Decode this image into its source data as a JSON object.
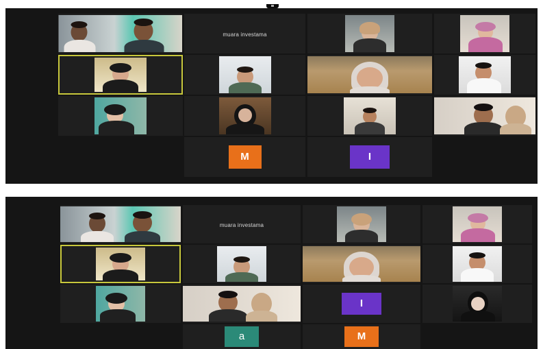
{
  "colors": {
    "background": "#151515",
    "tile": "#1f1f1f",
    "active_speaker_border": "#c8c83c",
    "tile_orange": "#e8701a",
    "tile_purple": "#6a34c8",
    "tile_teal": "#2b8a78"
  },
  "top_screen": {
    "label": "",
    "tiles": [
      {
        "id": "t1",
        "name": "",
        "org": "",
        "initial": ""
      },
      {
        "id": "t2",
        "name": "",
        "org": "muara investama",
        "initial": ""
      },
      {
        "id": "t3",
        "name": "",
        "org": "",
        "initial": ""
      },
      {
        "id": "t4",
        "name": "",
        "org": "",
        "initial": ""
      },
      {
        "id": "t5",
        "name": "",
        "org": "",
        "initial": ""
      },
      {
        "id": "t6",
        "name": "",
        "org": "",
        "initial": ""
      },
      {
        "id": "t7",
        "name": "",
        "org": "",
        "initial": ""
      },
      {
        "id": "t8",
        "name": "",
        "org": "",
        "initial": ""
      },
      {
        "id": "t9",
        "name": "",
        "org": "",
        "initial": ""
      },
      {
        "id": "t10",
        "name": "",
        "org": "",
        "initial": ""
      },
      {
        "id": "t11",
        "name": "",
        "org": "",
        "initial": ""
      },
      {
        "id": "t12",
        "name": "",
        "org": "",
        "initial": ""
      },
      {
        "id": "t13",
        "name": "",
        "org": "",
        "initial": "M"
      },
      {
        "id": "t14",
        "name": "",
        "org": "",
        "initial": "I"
      }
    ]
  },
  "bottom_screen": {
    "label": "",
    "tiles": [
      {
        "id": "b1",
        "name": "",
        "org": "",
        "initial": ""
      },
      {
        "id": "b2",
        "name": "",
        "org": "muara investama",
        "initial": ""
      },
      {
        "id": "b3",
        "name": "",
        "org": "",
        "initial": ""
      },
      {
        "id": "b4",
        "name": "",
        "org": "",
        "initial": ""
      },
      {
        "id": "b5",
        "name": "",
        "org": "",
        "initial": ""
      },
      {
        "id": "b6",
        "name": "",
        "org": "",
        "initial": ""
      },
      {
        "id": "b7",
        "name": "",
        "org": "",
        "initial": ""
      },
      {
        "id": "b8",
        "name": "",
        "org": "",
        "initial": ""
      },
      {
        "id": "b9",
        "name": "",
        "org": "",
        "initial": ""
      },
      {
        "id": "b10",
        "name": "",
        "org": "",
        "initial": ""
      },
      {
        "id": "b11",
        "name": "",
        "org": "",
        "initial": "I"
      },
      {
        "id": "b12",
        "name": "",
        "org": "",
        "initial": ""
      },
      {
        "id": "b13",
        "name": "",
        "org": "",
        "initial": "a"
      },
      {
        "id": "b14",
        "name": "",
        "org": "",
        "initial": "M"
      }
    ]
  }
}
